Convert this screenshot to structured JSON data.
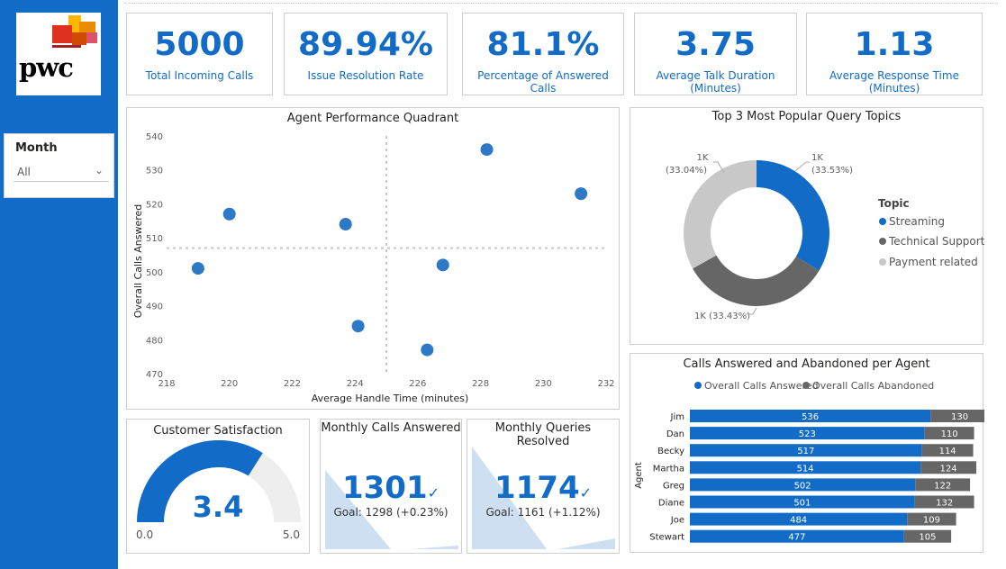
{
  "colors": {
    "accent": "#116bc7",
    "dark_gray": "#666666",
    "light_gray": "#c8c8c8",
    "area": "#cddff1"
  },
  "logo": {
    "text": "pwc"
  },
  "filter": {
    "title": "Month",
    "selected": "All"
  },
  "kpis": [
    {
      "value": "5000",
      "label": "Total Incoming Calls"
    },
    {
      "value": "89.94%",
      "label": "Issue Resolution Rate"
    },
    {
      "value": "81.1%",
      "label": "Percentage of Answered Calls"
    },
    {
      "value": "3.75",
      "label": "Average Talk Duration (Minutes)"
    },
    {
      "value": "1.13",
      "label": "Average Response Time (Minutes)"
    }
  ],
  "scatter": {
    "title": "Agent Performance Quadrant",
    "chart_data": {
      "type": "scatter",
      "xlabel": "Average Handle Time (minutes)",
      "ylabel": "Overall Calls Answered",
      "xlim": [
        218,
        232
      ],
      "ylim": [
        470,
        540
      ],
      "x_ticks": [
        218,
        220,
        222,
        224,
        226,
        228,
        230,
        232
      ],
      "y_ticks": [
        470,
        480,
        490,
        500,
        510,
        520,
        530,
        540
      ],
      "points": [
        {
          "x": 219.0,
          "y": 501
        },
        {
          "x": 220.0,
          "y": 517
        },
        {
          "x": 223.7,
          "y": 514
        },
        {
          "x": 224.1,
          "y": 484
        },
        {
          "x": 226.3,
          "y": 477
        },
        {
          "x": 226.8,
          "y": 502
        },
        {
          "x": 228.2,
          "y": 536
        },
        {
          "x": 231.2,
          "y": 523
        }
      ],
      "ref_x": 225.0,
      "ref_y": 507.0
    }
  },
  "donut": {
    "title": "Top 3 Most Popular Query Topics",
    "legend_title": "Topic",
    "chart_data": {
      "type": "pie",
      "slices": [
        {
          "name": "Streaming",
          "value": 33.53,
          "label": "1K",
          "pct": "(33.53%)",
          "color": "#116bc7"
        },
        {
          "name": "Technical Support",
          "value": 33.43,
          "label": "1K (33.43%)",
          "color": "#666666"
        },
        {
          "name": "Payment related",
          "value": 33.04,
          "label": "1K",
          "pct": "(33.04%)",
          "color": "#c8c8c8"
        }
      ]
    }
  },
  "bars": {
    "title": "Calls Answered and Abandoned per Agent",
    "yaxis_label": "Agent",
    "chart_data": {
      "type": "bar",
      "orientation": "horizontal",
      "stacked": true,
      "categories": [
        "Jim",
        "Dan",
        "Becky",
        "Martha",
        "Greg",
        "Diane",
        "Joe",
        "Stewart"
      ],
      "series": [
        {
          "name": "Overall Calls Answered",
          "color": "#116bc7",
          "values": [
            536,
            523,
            517,
            514,
            502,
            501,
            484,
            477
          ]
        },
        {
          "name": "Overall Calls Abandoned",
          "color": "#666666",
          "values": [
            130,
            110,
            114,
            124,
            122,
            132,
            109,
            105
          ]
        }
      ]
    }
  },
  "gauge": {
    "title": "Customer Satisfaction",
    "value": 3.4,
    "value_text": "3.4",
    "min": "0.0",
    "max": "5.0",
    "min_val": 0,
    "max_val": 5
  },
  "monthly_calls": {
    "title": "Monthly Calls Answered",
    "value": "1301",
    "goal": "Goal: 1298 (+0.23%)"
  },
  "monthly_queries": {
    "title": "Monthly Queries Resolved",
    "value": "1174",
    "goal": "Goal: 1161 (+1.12%)"
  }
}
